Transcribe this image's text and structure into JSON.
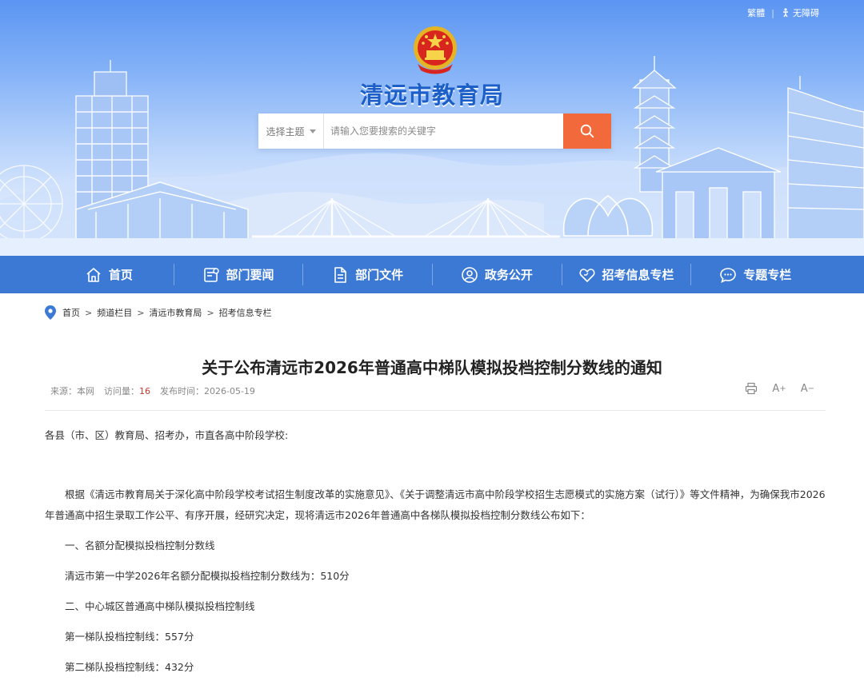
{
  "top_links": {
    "traditional": "繁體",
    "accessibility": "无障碍"
  },
  "site": {
    "title": "清远市教育局"
  },
  "search": {
    "select_label": "选择主题",
    "placeholder": "请输入您要搜索的关键字"
  },
  "nav": {
    "items": [
      {
        "label": "首页",
        "icon": "home-icon"
      },
      {
        "label": "部门要闻",
        "icon": "news-icon"
      },
      {
        "label": "部门文件",
        "icon": "document-icon"
      },
      {
        "label": "政务公开",
        "icon": "user-circle-icon"
      },
      {
        "label": "招考信息专栏",
        "icon": "heart-icon"
      },
      {
        "label": "专题专栏",
        "icon": "chat-icon"
      }
    ]
  },
  "breadcrumb": [
    "首页",
    "频道栏目",
    "清远市教育局",
    "招考信息专栏"
  ],
  "article": {
    "title": "关于公布清远市2026年普通高中梯队模拟投档控制分数线的通知",
    "source_label": "来源：本网",
    "visits_label": "访问量：",
    "visits": "16",
    "date_label": "发布时间：2026-05-19",
    "paragraphs": [
      "各县（市、区）教育局、招考办，市直各高中阶段学校:",
      "根据《清远市教育局关于深化高中阶段学校考试招生制度改革的实施意见》、《关于调整清远市高中阶段学校招生志愿模式的实施方案（试行）》等文件精神，为确保我市2026年普通高中招生录取工作公平、有序开展，经研究决定，现将清远市2026年普通高中各梯队模拟投档控制分数线公布如下：",
      "一、名额分配模拟投档控制分数线",
      "清远市第一中学2026年名额分配模拟投档控制分数线为：510分",
      "二、中心城区普通高中梯队模拟投档控制线",
      "第一梯队投档控制线：557分",
      "第二梯队投档控制线：432分"
    ]
  },
  "tools": {
    "font_increase": "A",
    "font_decrease": "A"
  },
  "colors": {
    "nav_bg": "#3b79d4",
    "search_button": "#f26a3b",
    "title_blue": "#1d5fc8",
    "visits": "#c0392b"
  }
}
